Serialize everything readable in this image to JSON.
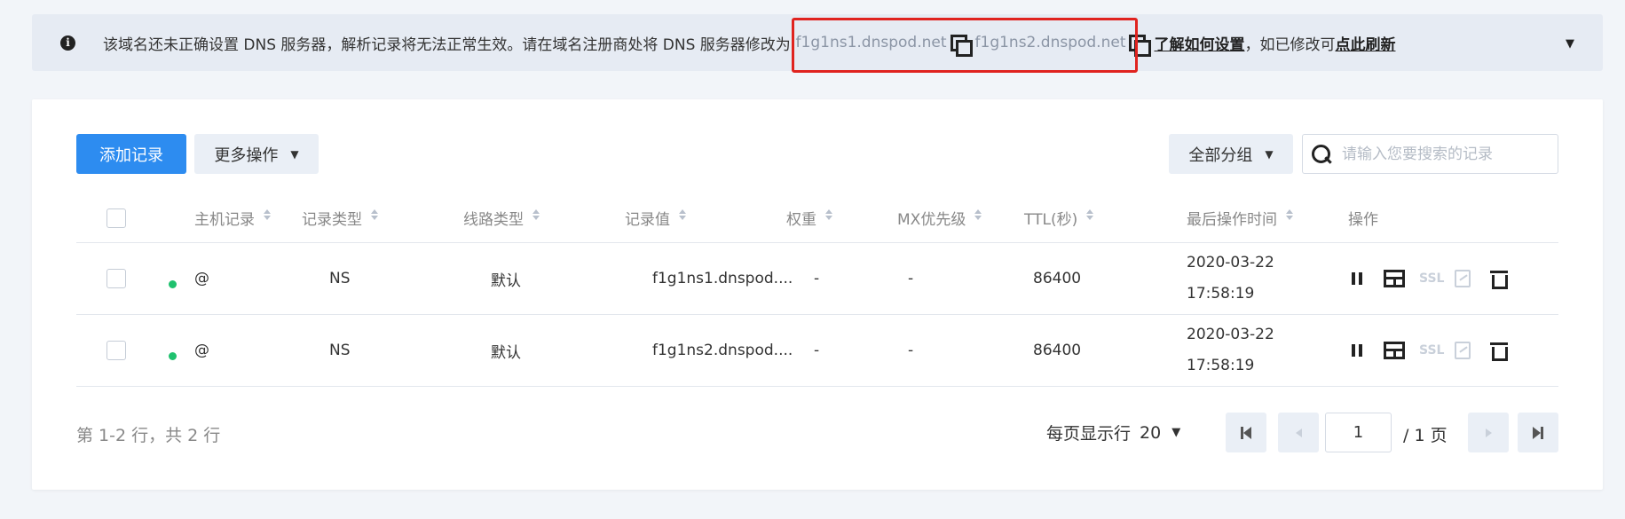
{
  "notice": {
    "text_before": "该域名还未正确设置 DNS 服务器，解析记录将无法正常生效。请在域名注册商处将 DNS 服务器修改为:",
    "ns1": "f1g1ns1.dnspod.net",
    "ns2": "f1g1ns2.dnspod.net",
    "learn_link": "了解如何设置",
    "text_mid": "，如已修改可",
    "refresh_link": "点此刷新",
    "caret": "▼"
  },
  "toolbar": {
    "add_label": "添加记录",
    "more_label": "更多操作",
    "group_label": "全部分组",
    "search_placeholder": "请输入您要搜索的记录"
  },
  "table": {
    "headers": {
      "host": "主机记录",
      "type": "记录类型",
      "line": "线路类型",
      "value": "记录值",
      "weight": "权重",
      "mx": "MX优先级",
      "ttl": "TTL(秒)",
      "time": "最后操作时间",
      "ops": "操作"
    },
    "rows": [
      {
        "host": "@",
        "type": "NS",
        "line": "默认",
        "value": "f1g1ns1.dnspod....",
        "weight": "-",
        "mx": "-",
        "ttl": "86400",
        "date": "2020-03-22",
        "time": "17:58:19",
        "status": "enabled"
      },
      {
        "host": "@",
        "type": "NS",
        "line": "默认",
        "value": "f1g1ns2.dnspod....",
        "weight": "-",
        "mx": "-",
        "ttl": "86400",
        "date": "2020-03-22",
        "time": "17:58:19",
        "status": "enabled"
      }
    ],
    "ssl_label": "SSL"
  },
  "footer": {
    "summary": "第 1-2 行，共 2 行",
    "page_size_label": "每页显示行",
    "page_size": "20",
    "current_page": "1",
    "total_pages": "/ 1 页"
  },
  "colors": {
    "primary": "#2d8cf0",
    "status_enabled": "#1fc16e",
    "highlight": "#e0231f"
  }
}
